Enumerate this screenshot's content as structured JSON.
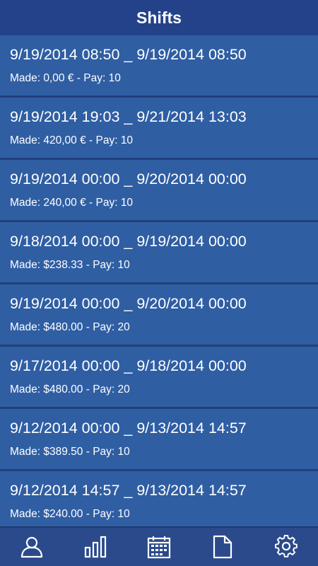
{
  "header": {
    "title": "Shifts"
  },
  "shifts": [
    {
      "range": "9/19/2014 08:50 _ 9/19/2014 08:50",
      "detail": "Made: 0,00 € - Pay: 10"
    },
    {
      "range": "9/19/2014 19:03 _ 9/21/2014 13:03",
      "detail": "Made: 420,00 € - Pay: 10"
    },
    {
      "range": "9/19/2014 00:00 _ 9/20/2014 00:00",
      "detail": "Made: 240,00 € - Pay: 10"
    },
    {
      "range": "9/18/2014 00:00 _ 9/19/2014 00:00",
      "detail": "Made: $238.33 - Pay: 10"
    },
    {
      "range": "9/19/2014 00:00 _ 9/20/2014 00:00",
      "detail": "Made: $480.00 - Pay: 20"
    },
    {
      "range": "9/17/2014 00:00 _ 9/18/2014 00:00",
      "detail": "Made: $480.00 - Pay: 20"
    },
    {
      "range": "9/12/2014 00:00 _ 9/13/2014 14:57",
      "detail": "Made: $389.50 - Pay: 10"
    },
    {
      "range": "9/12/2014 14:57 _ 9/13/2014 14:57",
      "detail": "Made: $240.00 - Pay: 10"
    }
  ],
  "tabbar": {
    "icons": [
      "person-icon",
      "bar-chart-icon",
      "calendar-icon",
      "document-icon",
      "gear-icon"
    ]
  },
  "colors": {
    "header_bg": "#24428a",
    "item_bg": "#2f5ea3",
    "tabbar_bg": "#2b4a8c",
    "text": "#ffffff"
  }
}
